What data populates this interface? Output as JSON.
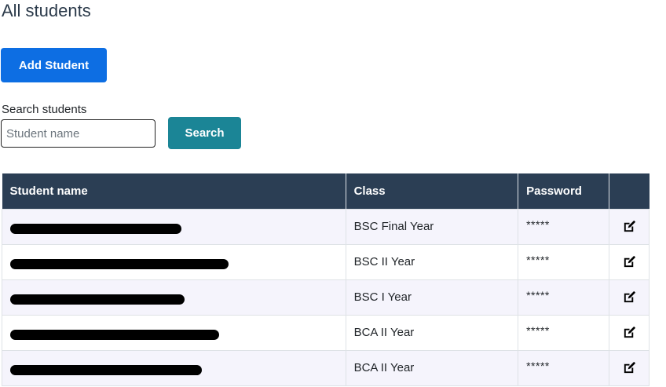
{
  "page": {
    "title": "All students"
  },
  "actions": {
    "add_label": "Add Student"
  },
  "search": {
    "label": "Search students",
    "placeholder": "Student name",
    "value": "",
    "button_label": "Search"
  },
  "table": {
    "headers": {
      "name": "Student name",
      "class": "Class",
      "password": "Password",
      "actions": ""
    },
    "rows": [
      {
        "name": "",
        "class": "BSC Final Year",
        "password": "*****",
        "icon": "edit-icon"
      },
      {
        "name": "",
        "class": "BSC II Year",
        "password": "*****",
        "icon": "edit-icon"
      },
      {
        "name": "",
        "class": "BSC I Year",
        "password": "*****",
        "icon": "edit-icon"
      },
      {
        "name": "",
        "class": "BCA II Year",
        "password": "*****",
        "icon": "edit-icon"
      },
      {
        "name": "",
        "class": "BCA II Year",
        "password": "*****",
        "icon": "edit-icon"
      }
    ]
  },
  "colors": {
    "primary": "#0d6ee3",
    "info": "#1b8596",
    "table_header": "#2b3e54",
    "stripe": "#f5f4fc"
  }
}
